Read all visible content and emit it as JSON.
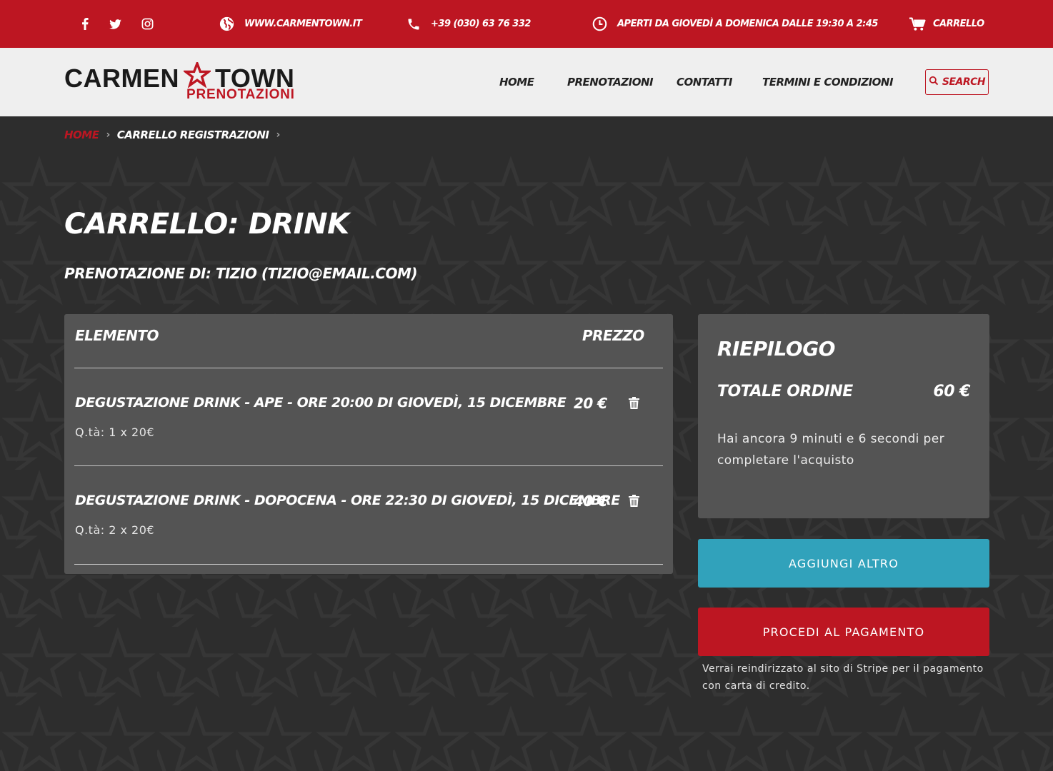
{
  "topbar": {
    "social": [
      {
        "icon": "facebook-icon"
      },
      {
        "icon": "twitter-icon"
      },
      {
        "icon": "instagram-icon"
      }
    ],
    "website": "www.carmentown.it",
    "phone": "+39 (030) 63 76 332",
    "hours": "Aperti da Giovedì a Domenica dalle 19:30 a 2:45",
    "cart_label": "Carrello",
    "bg_color": "#bd1622"
  },
  "header": {
    "logo_top_left": "CARMEN",
    "logo_top_right": "TOWN",
    "logo_sub": "PRENOTAZIONI",
    "nav": [
      "Home",
      "Prenotazioni",
      "Contatti",
      "Termini e condizioni"
    ],
    "search_label": "Search"
  },
  "breadcrumb": {
    "home": "Home",
    "current": "Carrello registrazioni"
  },
  "page": {
    "title": "Carrello: Drink",
    "subtitle": "Prenotazione di: Tizio (tizio@email.com)"
  },
  "cart": {
    "col_item": "Elemento",
    "col_price": "Prezzo",
    "items": [
      {
        "name": "Degustazione Drink - APE - ore 20:00 di Giovedì, 15 Dicembre",
        "qty": "Q.tà: 1 x 20€",
        "price": "20 €"
      },
      {
        "name": "Degustazione Drink - DOPOCENA - ore 22:30 di Giovedì, 15 Dicembre",
        "qty": "Q.tà: 2 x 20€",
        "price": "40 €"
      }
    ]
  },
  "summary": {
    "title": "Riepilogo",
    "total_label": "Totale ordine",
    "total_value": "60 €",
    "note": "Hai ancora 9 minuti e 6 secondi per completare l'acquisto"
  },
  "actions": {
    "add_more": "AGGIUNGI ALTRO",
    "checkout": "PROCEDI AL PAGAMENTO",
    "stripe_note": "Verrai reindirizzato al sito di Stripe per il pagamento con carta di credito.",
    "add_more_color": "#31a2bb",
    "checkout_color": "#bd1622"
  }
}
